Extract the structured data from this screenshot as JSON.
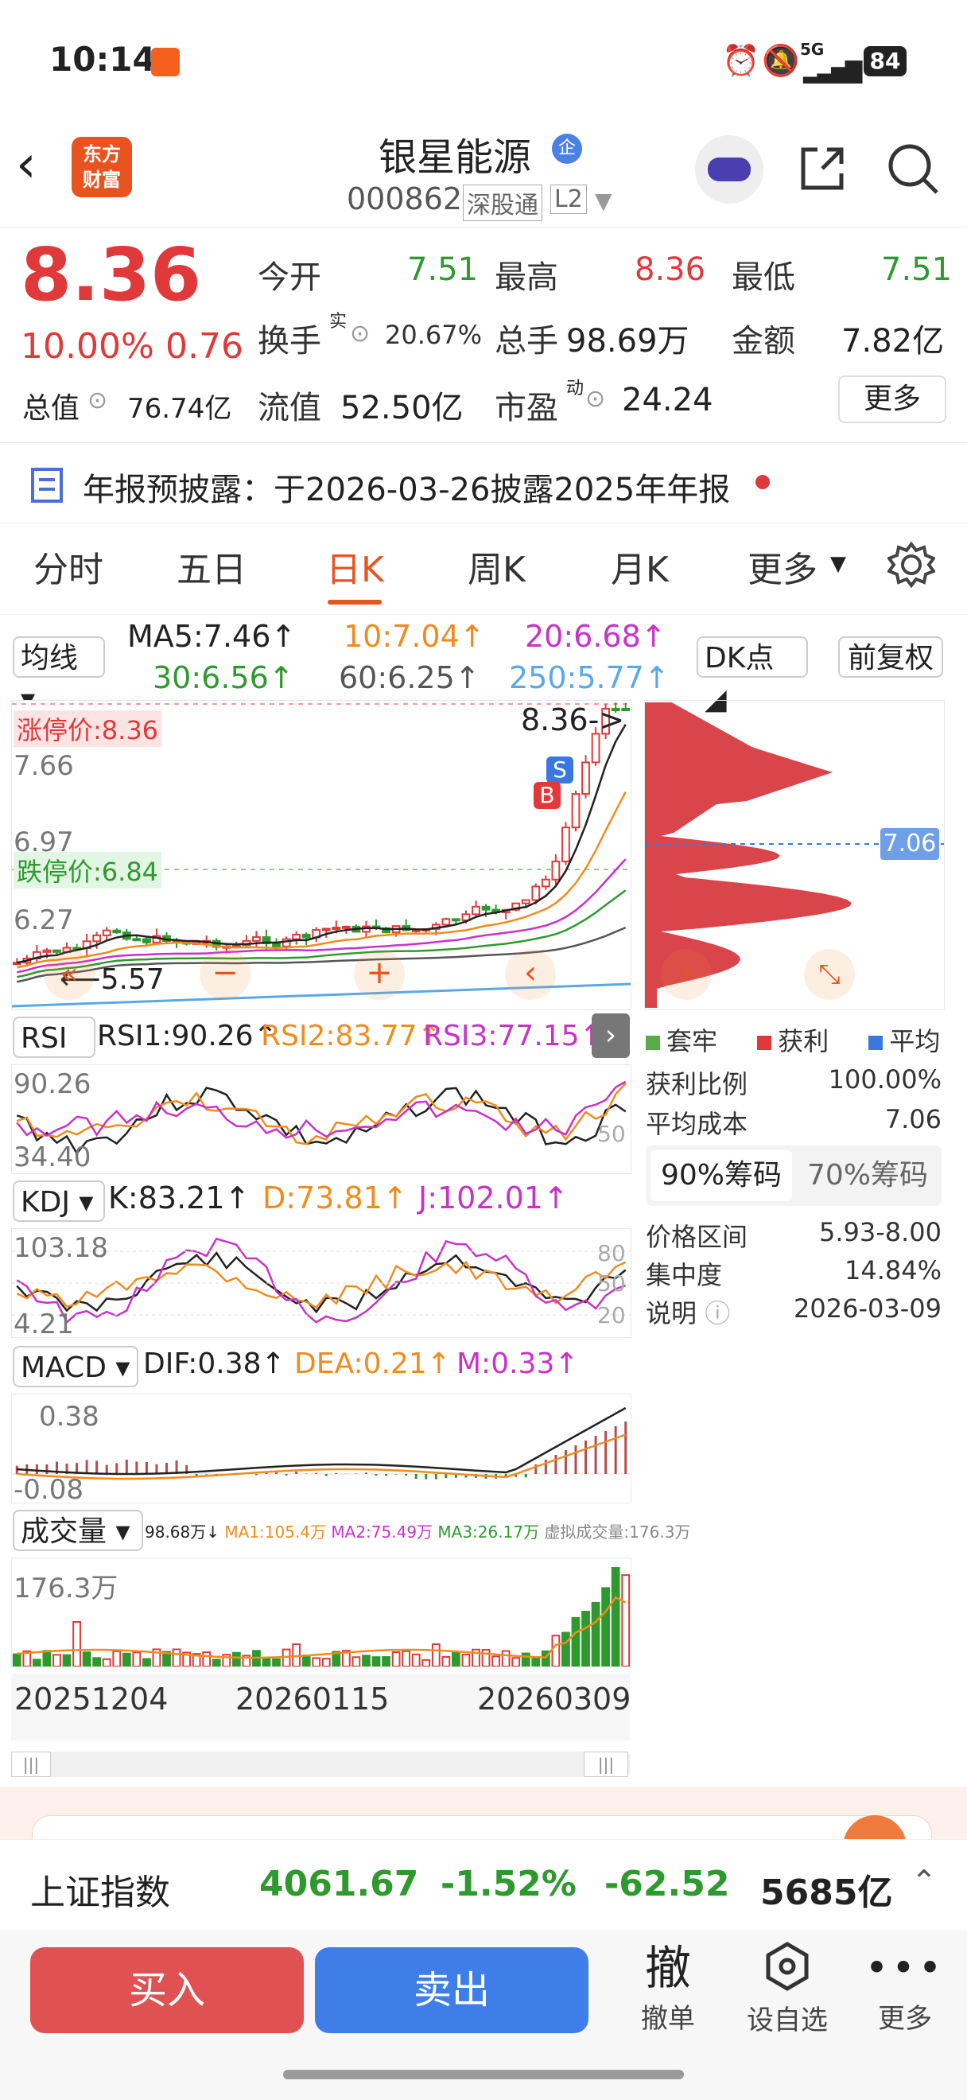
{
  "status_bar": {
    "time": "10:14",
    "net": "5G",
    "battery": "84"
  },
  "header": {
    "stock_name": "银星能源",
    "code": "000862",
    "tag1": "深股通",
    "tag2": "L2",
    "logo_line1": "东方",
    "logo_line2": "财富",
    "badge": "企"
  },
  "quote": {
    "price": "8.36",
    "pct": "10.00%",
    "chg": "0.76",
    "open_label": "今开",
    "open": "7.51",
    "high_label": "最高",
    "high": "8.36",
    "low_label": "最低",
    "low": "7.51",
    "turnover_label": "换手",
    "turnover_sup": "实",
    "turnover": "20.67%",
    "vol_label": "总手",
    "vol": "98.69万",
    "amt_label": "金额",
    "amt": "7.82亿",
    "mcap_label": "总值",
    "mcap": "76.74亿",
    "float_label": "流值",
    "float": "52.50亿",
    "pe_label": "市盈",
    "pe_sup": "动",
    "pe": "24.24",
    "more": "更多"
  },
  "notice": {
    "text": "年报预披露：于2026-03-26披露2025年年报"
  },
  "tabs": [
    "分时",
    "五日",
    "日K",
    "周K",
    "月K",
    "更多"
  ],
  "active_tab": 2,
  "ma_row": {
    "select": "均线",
    "ma5": "MA5:7.46↑",
    "ma10": "10:7.04↑",
    "ma20": "20:6.68↑",
    "ma30": "30:6.56↑",
    "ma60": "60:6.25↑",
    "ma250": "250:5.77↑",
    "dk": "DK点",
    "fq": "前复权"
  },
  "kline": {
    "limit_up": "涨停价:8.36",
    "limit_down": "跌停价:6.84",
    "y1": "7.66",
    "y2": "6.97",
    "y3": "6.27",
    "y4": "5.57",
    "low_mark": "5.57",
    "high_mark": "8.36->",
    "b": "B",
    "s": "S",
    "cost_tag": "7.06"
  },
  "rsi": {
    "select": "RSI",
    "v1": "RSI1:90.26↑",
    "v2": "RSI2:83.77↑",
    "v3": "RSI3:77.15↑",
    "ytop": "90.26",
    "ybot": "34.40",
    "ymid": "50"
  },
  "kdj": {
    "select": "KDJ",
    "k": "K:83.21↑",
    "d": "D:73.81↑",
    "j": "J:102.01↑",
    "ytop": "103.18",
    "ybot": "4.21",
    "r80": "80",
    "r50": "50",
    "r20": "20"
  },
  "macd": {
    "select": "MACD",
    "dif": "DIF:0.38↑",
    "dea": "DEA:0.21↑",
    "m": "M:0.33↑",
    "ytop": "0.38",
    "ybot": "-0.08"
  },
  "volume": {
    "select": "成交量",
    "vol": "98.68万↓",
    "ma1": "MA1:105.4万",
    "ma2": "MA2:75.49万",
    "ma3": "MA3:26.17万",
    "virtual": "虚拟成交量:176.3万",
    "ytop": "176.3万"
  },
  "dates": [
    "20251204",
    "20260115",
    "20260309"
  ],
  "chips": {
    "legend": [
      "套牢",
      "获利",
      "平均"
    ],
    "profit_label": "获利比例",
    "profit": "100.00%",
    "avg_label": "平均成本",
    "avg": "7.06",
    "tab90": "90%筹码",
    "tab70": "70%筹码",
    "range_label": "价格区间",
    "range": "5.93-8.00",
    "conc_label": "集中度",
    "conc": "14.84%",
    "desc_label": "说明",
    "desc": "2026-03-09"
  },
  "index_bar": {
    "name": "上证指数",
    "value": "4061.67",
    "pct": "-1.52%",
    "chg": "-62.52",
    "amount": "5685亿"
  },
  "bottom": {
    "buy": "买入",
    "sell": "卖出",
    "cancel_big": "撤",
    "cancel": "撤单",
    "fav": "设自选",
    "more": "更多"
  },
  "colors": {
    "red": "#e0393a",
    "green": "#2e9a2e",
    "blue": "#3a78e0",
    "orange": "#f08c1e",
    "magenta": "#c832c8"
  }
}
